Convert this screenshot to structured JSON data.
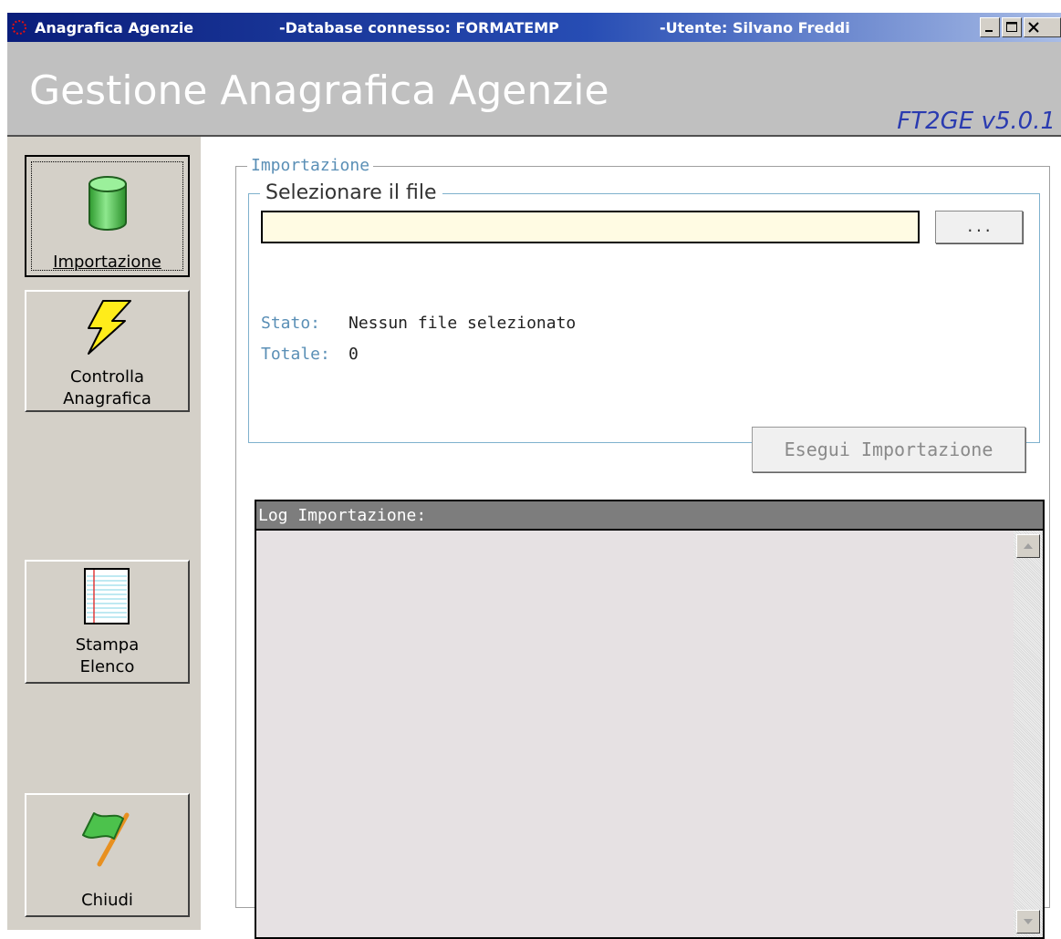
{
  "titlebar": {
    "app_name": "Anagrafica Agenzie",
    "database": "-Database connesso: FORMATEMP",
    "user": "-Utente: Silvano Freddi"
  },
  "header": {
    "title": "Gestione Anagrafica Agenzie",
    "version": "FT2GE v5.0.1"
  },
  "sidebar": {
    "items": [
      {
        "label": "Importazione",
        "icon": "database-cylinder-icon",
        "active": true
      },
      {
        "label1": "Controlla",
        "label2": "Anagrafica",
        "icon": "lightning-icon"
      },
      {
        "label1": "Stampa",
        "label2": "Elenco",
        "icon": "notebook-icon"
      },
      {
        "label": "Chiudi",
        "icon": "flag-icon"
      }
    ]
  },
  "import": {
    "legend": "Importazione",
    "file_legend": "Selezionare il file",
    "file_value": "",
    "browse_label": "...",
    "stato_label": "Stato:",
    "stato_value": "Nessun file selezionato",
    "totale_label": "Totale:",
    "totale_value": "0",
    "execute_label": "Esegui Importazione"
  },
  "log": {
    "header": "Log Importazione:"
  },
  "colors": {
    "title_accent": "#2a3bb0",
    "label_blue": "#5a8fb6",
    "input_bg": "#fffbe3",
    "log_bg": "#e6e1e3"
  }
}
